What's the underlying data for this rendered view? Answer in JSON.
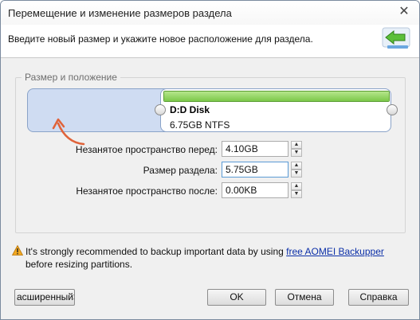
{
  "window": {
    "title": "Перемещение и изменение размеров раздела",
    "close_glyph": "✕"
  },
  "header": {
    "instruction": "Введите новый размер и укажите новое расположение для раздела.",
    "icon": "green-resize-arrow-icon"
  },
  "group": {
    "label": "Размер и положение"
  },
  "partition": {
    "name": "D:D Disk",
    "info": "6.75GB NTFS",
    "used_fraction": 1.0
  },
  "fields": {
    "before_label": "Незанятое пространство перед:",
    "before_value": "4.10GB",
    "size_label": "Размер раздела:",
    "size_value": "5.75GB",
    "after_label": "Незанятое пространство после:",
    "after_value": "0.00KB"
  },
  "warning": {
    "icon": "warning-icon",
    "text_before": "It's strongly recommended to backup important data by using ",
    "link_text": "free AOMEI Backupper",
    "text_after": " before resizing partitions."
  },
  "buttons": {
    "advanced": "асширенный>>",
    "ok": "OK",
    "cancel": "Отмена",
    "help": "Справка"
  },
  "colors": {
    "accent_green": "#7cc84a",
    "unallocated": "#cfdcf2",
    "annotation_arrow": "#e0633a"
  }
}
